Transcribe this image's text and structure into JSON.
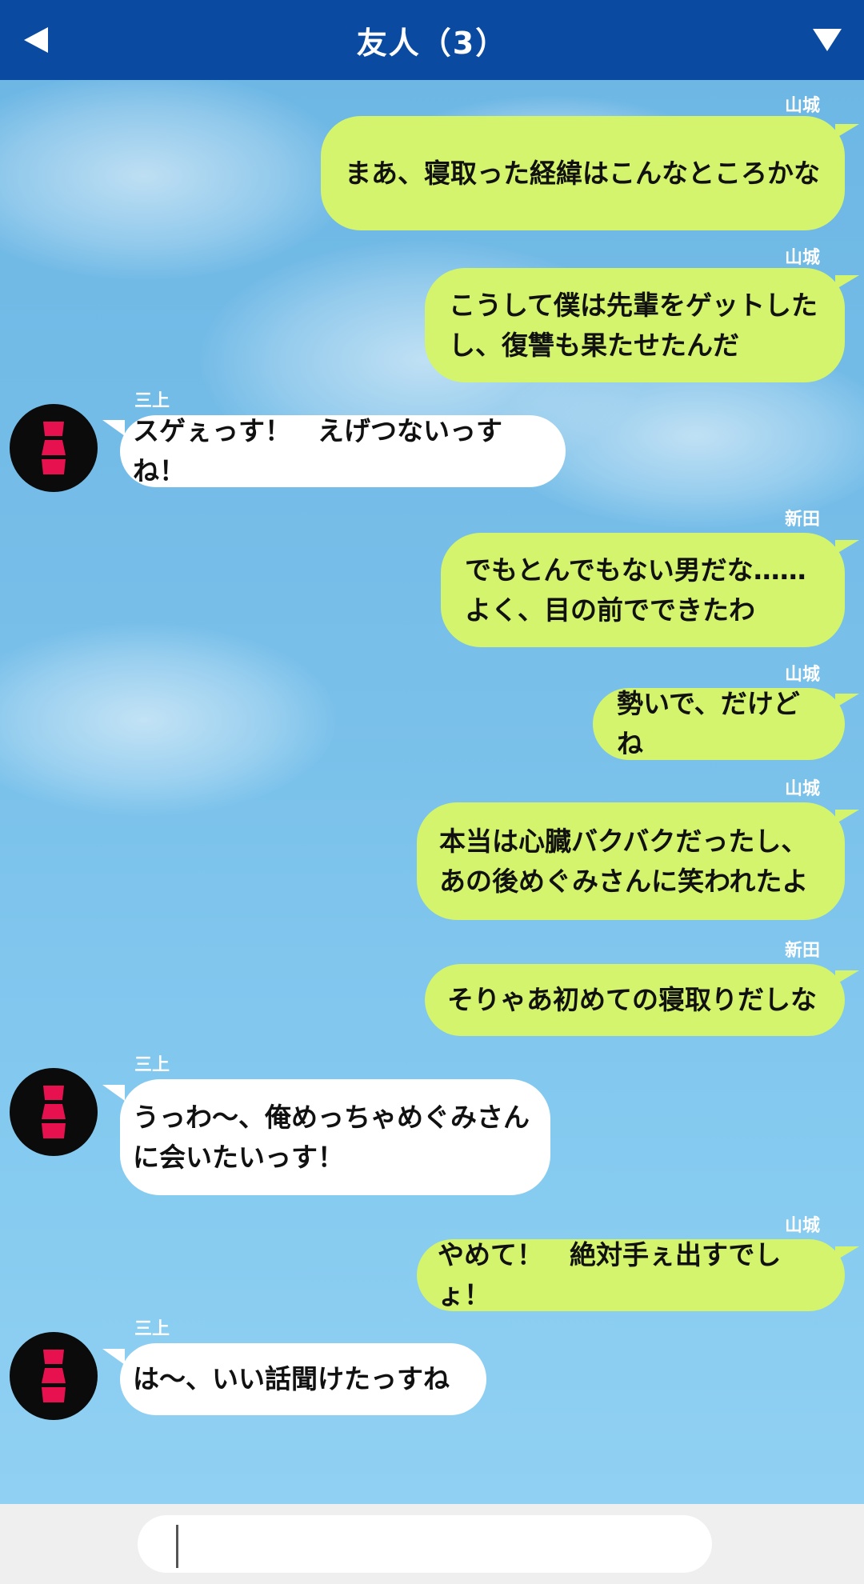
{
  "header": {
    "title": "友人（3）",
    "back_icon": "back-triangle-icon",
    "menu_icon": "dropdown-triangle-icon"
  },
  "colors": {
    "header": "#0a4aa0",
    "outgoing_bubble": "#d3f46c",
    "incoming_bubble": "#ffffff",
    "avatar_accent": "#e8114f"
  },
  "messages": [
    {
      "sender": "山城",
      "side": "out",
      "text": "まあ、寝取った経緯はこんなところかな"
    },
    {
      "sender": "山城",
      "side": "out",
      "text": "こうして僕は先輩をゲットした\nし、復讐も果たせたんだ"
    },
    {
      "sender": "三上",
      "side": "in",
      "text": "スゲぇっす！　えげつないっすね！"
    },
    {
      "sender": "新田",
      "side": "out",
      "text": "でもとんでもない男だな……\nよく、目の前でできたわ"
    },
    {
      "sender": "山城",
      "side": "out",
      "text": "勢いで、だけどね"
    },
    {
      "sender": "山城",
      "side": "out",
      "text": "本当は心臓バクバクだったし、\nあの後めぐみさんに笑われたよ"
    },
    {
      "sender": "新田",
      "side": "out",
      "text": "そりゃあ初めての寝取りだしな"
    },
    {
      "sender": "三上",
      "side": "in",
      "text": "うっわ～、俺めっちゃめぐみさん\nに会いたいっす！"
    },
    {
      "sender": "山城",
      "side": "out",
      "text": "やめて！　絶対手ぇ出すでしょ！"
    },
    {
      "sender": "三上",
      "side": "in",
      "text": "は～、いい話聞けたっすね"
    }
  ],
  "input": {
    "value": "",
    "placeholder": ""
  }
}
